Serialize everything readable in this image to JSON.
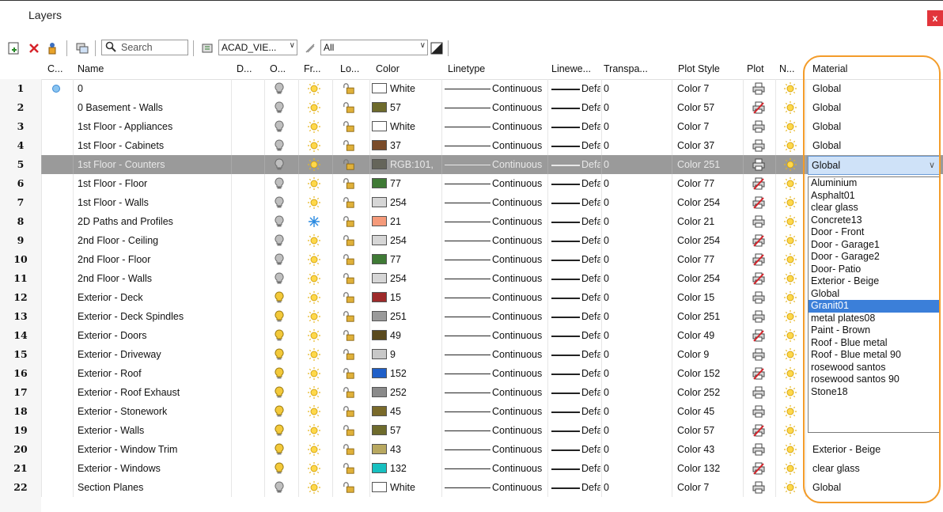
{
  "window": {
    "title": "Layers",
    "close_label": "x"
  },
  "toolbar": {
    "search_placeholder": "Search",
    "view_combo": "ACAD_VIE...",
    "filter_combo": "All"
  },
  "columns": [
    "C...",
    "Name",
    "D...",
    "O...",
    "Fr...",
    "Lo...",
    "Color",
    "Linetype",
    "Linewe...",
    "Transpa...",
    "Plot Style",
    "Plot",
    "N...",
    "Material"
  ],
  "rows": [
    {
      "num": "1",
      "name": "0",
      "color_label": "White",
      "color_hex": "#ffffff",
      "linetype": "Continuous",
      "lineweight": "Defa",
      "transparency": "0",
      "plot_style": "Color 7",
      "material": "Global",
      "on": false,
      "frozen": false,
      "plot": true,
      "current": true
    },
    {
      "num": "2",
      "name": "0 Basement - Walls",
      "color_label": "57",
      "color_hex": "#6e6b2c",
      "linetype": "Continuous",
      "lineweight": "Defa",
      "transparency": "0",
      "plot_style": "Color 57",
      "material": "Global",
      "on": false,
      "frozen": false,
      "plot": false,
      "current": false
    },
    {
      "num": "3",
      "name": "1st Floor - Appliances",
      "color_label": "White",
      "color_hex": "#ffffff",
      "linetype": "Continuous",
      "lineweight": "Defa",
      "transparency": "0",
      "plot_style": "Color 7",
      "material": "Global",
      "on": false,
      "frozen": false,
      "plot": true,
      "current": false
    },
    {
      "num": "4",
      "name": "1st Floor - Cabinets",
      "color_label": "37",
      "color_hex": "#7a4c2a",
      "linetype": "Continuous",
      "lineweight": "Defa",
      "transparency": "0",
      "plot_style": "Color 37",
      "material": "Global",
      "on": false,
      "frozen": false,
      "plot": true,
      "current": false
    },
    {
      "num": "5",
      "name": "1st Floor - Counters",
      "color_label": "RGB:101,",
      "color_hex": "#65655a",
      "linetype": "Continuous",
      "lineweight": "Defa",
      "transparency": "0",
      "plot_style": "Color 251",
      "material": "Global",
      "on": false,
      "frozen": false,
      "plot": true,
      "current": false,
      "selected": true
    },
    {
      "num": "6",
      "name": "1st Floor - Floor",
      "color_label": "77",
      "color_hex": "#3f7a35",
      "linetype": "Continuous",
      "lineweight": "Defa",
      "transparency": "0",
      "plot_style": "Color 77",
      "material": "",
      "on": false,
      "frozen": false,
      "plot": false,
      "current": false
    },
    {
      "num": "7",
      "name": "1st Floor - Walls",
      "color_label": "254",
      "color_hex": "#d6d6d6",
      "linetype": "Continuous",
      "lineweight": "Defa",
      "transparency": "0",
      "plot_style": "Color 254",
      "material": "",
      "on": false,
      "frozen": false,
      "plot": false,
      "current": false
    },
    {
      "num": "8",
      "name": "2D Paths and Profiles",
      "color_label": "21",
      "color_hex": "#f59a7a",
      "linetype": "Continuous",
      "lineweight": "Defa",
      "transparency": "0",
      "plot_style": "Color 21",
      "material": "",
      "on": false,
      "frozen": true,
      "plot": true,
      "current": false
    },
    {
      "num": "9",
      "name": "2nd Floor - Ceiling",
      "color_label": "254",
      "color_hex": "#d6d6d6",
      "linetype": "Continuous",
      "lineweight": "Defa",
      "transparency": "0",
      "plot_style": "Color 254",
      "material": "",
      "on": false,
      "frozen": false,
      "plot": false,
      "current": false
    },
    {
      "num": "10",
      "name": "2nd Floor - Floor",
      "color_label": "77",
      "color_hex": "#3f7a35",
      "linetype": "Continuous",
      "lineweight": "Defa",
      "transparency": "0",
      "plot_style": "Color 77",
      "material": "",
      "on": false,
      "frozen": false,
      "plot": false,
      "current": false
    },
    {
      "num": "11",
      "name": "2nd Floor - Walls",
      "color_label": "254",
      "color_hex": "#d6d6d6",
      "linetype": "Continuous",
      "lineweight": "Defa",
      "transparency": "0",
      "plot_style": "Color 254",
      "material": "",
      "on": false,
      "frozen": false,
      "plot": false,
      "current": false
    },
    {
      "num": "12",
      "name": "Exterior - Deck",
      "color_label": "15",
      "color_hex": "#9e2a2a",
      "linetype": "Continuous",
      "lineweight": "Defa",
      "transparency": "0",
      "plot_style": "Color 15",
      "material": "",
      "on": true,
      "frozen": false,
      "plot": true,
      "current": false
    },
    {
      "num": "13",
      "name": "Exterior - Deck Spindles",
      "color_label": "251",
      "color_hex": "#9a9a9a",
      "linetype": "Continuous",
      "lineweight": "Defa",
      "transparency": "0",
      "plot_style": "Color 251",
      "material": "",
      "on": true,
      "frozen": false,
      "plot": true,
      "current": false
    },
    {
      "num": "14",
      "name": "Exterior - Doors",
      "color_label": "49",
      "color_hex": "#5a4a1e",
      "linetype": "Continuous",
      "lineweight": "Defa",
      "transparency": "0",
      "plot_style": "Color 49",
      "material": "",
      "on": true,
      "frozen": false,
      "plot": false,
      "current": false
    },
    {
      "num": "15",
      "name": "Exterior - Driveway",
      "color_label": "9",
      "color_hex": "#c8c8c8",
      "linetype": "Continuous",
      "lineweight": "Defa",
      "transparency": "0",
      "plot_style": "Color 9",
      "material": "",
      "on": true,
      "frozen": false,
      "plot": true,
      "current": false
    },
    {
      "num": "16",
      "name": "Exterior - Roof",
      "color_label": "152",
      "color_hex": "#1f5fc8",
      "linetype": "Continuous",
      "lineweight": "Defa",
      "transparency": "0",
      "plot_style": "Color 152",
      "material": "",
      "on": true,
      "frozen": false,
      "plot": false,
      "current": false
    },
    {
      "num": "17",
      "name": "Exterior - Roof Exhaust",
      "color_label": "252",
      "color_hex": "#8a8a8a",
      "linetype": "Continuous",
      "lineweight": "Defa",
      "transparency": "0",
      "plot_style": "Color 252",
      "material": "",
      "on": true,
      "frozen": false,
      "plot": true,
      "current": false
    },
    {
      "num": "18",
      "name": "Exterior - Stonework",
      "color_label": "45",
      "color_hex": "#7a6a2a",
      "linetype": "Continuous",
      "lineweight": "Defa",
      "transparency": "0",
      "plot_style": "Color 45",
      "material": "",
      "on": true,
      "frozen": false,
      "plot": true,
      "current": false
    },
    {
      "num": "19",
      "name": "Exterior - Walls",
      "color_label": "57",
      "color_hex": "#6e6b2c",
      "linetype": "Continuous",
      "lineweight": "Defa",
      "transparency": "0",
      "plot_style": "Color 57",
      "material": "",
      "on": true,
      "frozen": false,
      "plot": false,
      "current": false
    },
    {
      "num": "20",
      "name": "Exterior - Window Trim",
      "color_label": "43",
      "color_hex": "#b8a860",
      "linetype": "Continuous",
      "lineweight": "Defa",
      "transparency": "0",
      "plot_style": "Color 43",
      "material": "Exterior - Beige",
      "on": true,
      "frozen": false,
      "plot": true,
      "current": false
    },
    {
      "num": "21",
      "name": "Exterior - Windows",
      "color_label": "132",
      "color_hex": "#17c0c0",
      "linetype": "Continuous",
      "lineweight": "Defa",
      "transparency": "0",
      "plot_style": "Color 132",
      "material": "clear glass",
      "on": true,
      "frozen": false,
      "plot": false,
      "current": false
    },
    {
      "num": "22",
      "name": "Section Planes",
      "color_label": "White",
      "color_hex": "#ffffff",
      "linetype": "Continuous",
      "lineweight": "Defa",
      "transparency": "0",
      "plot_style": "Color 7",
      "material": "Global",
      "on": false,
      "frozen": false,
      "plot": true,
      "current": false
    }
  ],
  "material_combo": {
    "value": "Global"
  },
  "material_options": [
    "Aluminium",
    "Asphalt01",
    "clear glass",
    "Concrete13",
    "Door - Front",
    "Door - Garage1",
    "Door - Garage2",
    "Door- Patio",
    "Exterior - Beige",
    "Global",
    "Granit01",
    "metal plates08",
    "Paint - Brown",
    "Roof - Blue metal",
    "Roof - Blue metal 90",
    "rosewood santos",
    "rosewood santos 90",
    "Stone18"
  ],
  "material_highlighted": "Granit01",
  "colors": {
    "selected_row": "#9a9a9a",
    "dropdown_highlight": "#3b7fd9",
    "callout_ring": "#f39c2a",
    "close_button": "#e2353b"
  }
}
